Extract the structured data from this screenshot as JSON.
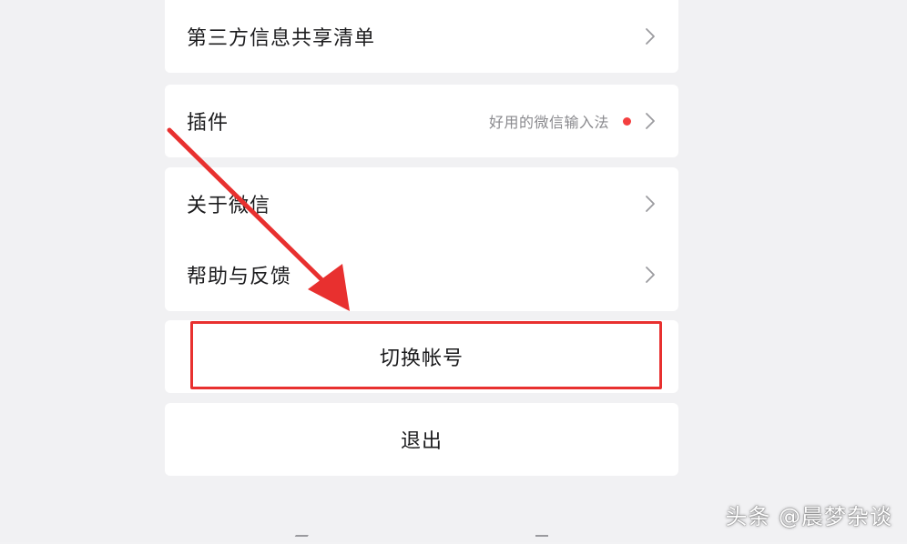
{
  "settings": {
    "items": [
      {
        "label": "第三方信息共享清单"
      },
      {
        "label": "插件",
        "sub": "好用的微信输入法"
      },
      {
        "label": "关于微信"
      },
      {
        "label": "帮助与反馈"
      }
    ],
    "switch_account": "切换帐号",
    "logout": "退出"
  },
  "watermark": "头条 @晨梦杂谈",
  "colors": {
    "highlight": "#e8302f",
    "badge": "#f43f3f",
    "background": "#f1f1f3"
  }
}
